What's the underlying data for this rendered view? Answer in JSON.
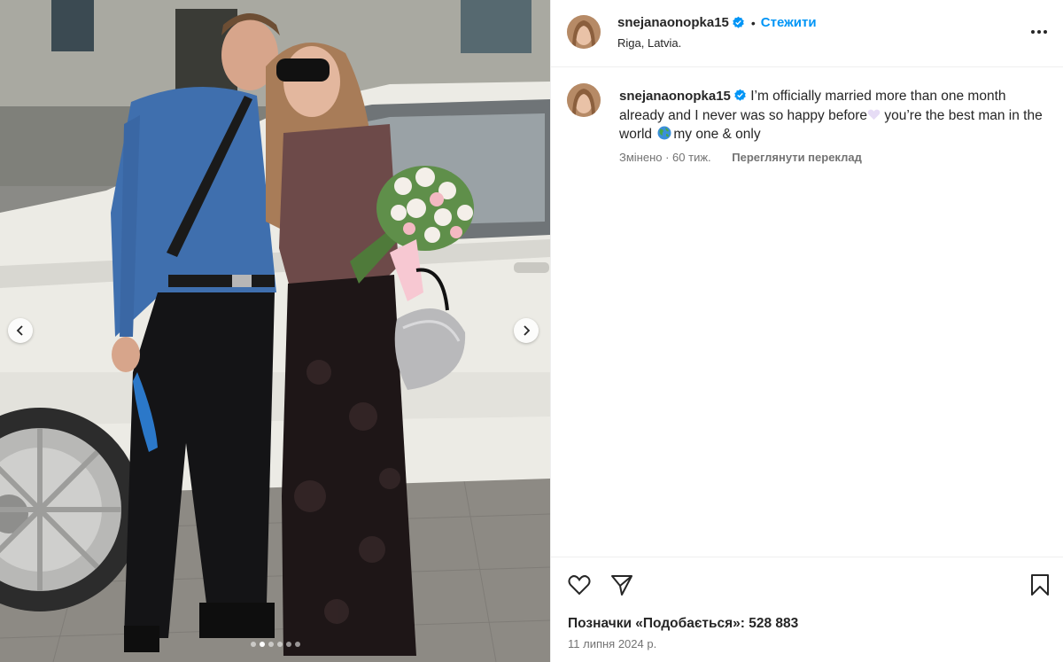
{
  "post": {
    "author": "snejanaonopka15",
    "verified": true,
    "follow_label": "Стежити",
    "separator": "•",
    "location": "Riga, Latvia."
  },
  "caption": {
    "username": "snejanaonopka15",
    "text_part1": " I’m officially married more than one month already and I never was so happy before",
    "text_part2": " you’re the best man in the world ",
    "text_part3": "my one & only",
    "edited_label": "Змінено · 60 тиж.",
    "translate_label": "Переглянути переклад"
  },
  "engagement": {
    "likes_label": "Позначки «Подобається»: 528 883",
    "date": "11 липня 2024 р."
  },
  "carousel": {
    "total_slides": 6,
    "active_slide": 2
  },
  "icons": {
    "verified": "verified-badge-icon",
    "more": "more-options-icon",
    "like": "heart-icon",
    "share": "share-icon",
    "save": "bookmark-icon",
    "prev": "chevron-left-icon",
    "next": "chevron-right-icon"
  },
  "colors": {
    "link": "#0095f6",
    "verified": "#0095f6",
    "text": "#262626",
    "muted": "#737373"
  }
}
